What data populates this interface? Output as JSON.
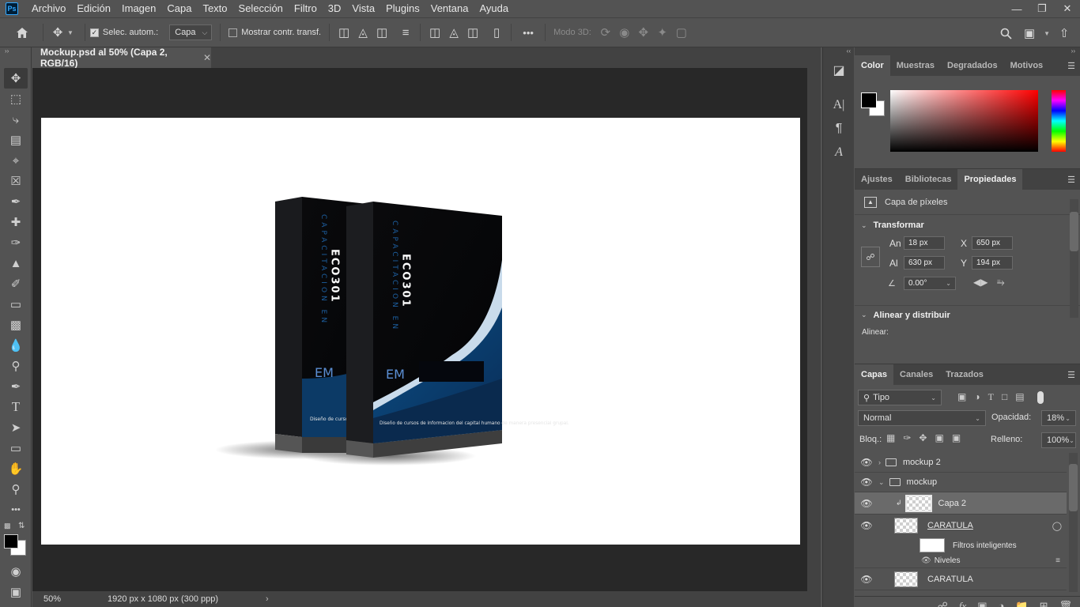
{
  "app": {
    "logo_text": "Ps",
    "menu": [
      "Archivo",
      "Edición",
      "Imagen",
      "Capa",
      "Texto",
      "Selección",
      "Filtro",
      "3D",
      "Vista",
      "Plugins",
      "Ventana",
      "Ayuda"
    ]
  },
  "options_bar": {
    "auto_select_label": "Selec. autom.:",
    "auto_select_checked": true,
    "auto_select_target": "Capa",
    "show_transform_label": "Mostrar contr. transf.",
    "show_transform_checked": false,
    "mode3d_label": "Modo 3D:",
    "more_label": "•••"
  },
  "document": {
    "tab_title": "Mockup.psd al 50% (Capa 2, RGB/16)",
    "zoom": "50%",
    "info": "1920 px x 1080 px (300 ppp)"
  },
  "mockup": {
    "vertical_text_a": "CAPACITACION EN",
    "vertical_text_b": "ECO301",
    "logo_text": "EM",
    "caption_front": "Diseño de cursos de informacion del capital humano de manera presencial grupal.",
    "caption_back": "Diseño de cursos capital humano d"
  },
  "color_panel": {
    "tabs": [
      "Color",
      "Muestras",
      "Degradados",
      "Motivos"
    ],
    "active_tab": "Color",
    "foreground": "#000000",
    "background": "#ffffff"
  },
  "properties_panel": {
    "tabs": [
      "Ajustes",
      "Bibliotecas",
      "Propiedades"
    ],
    "active_tab": "Propiedades",
    "layer_type": "Capa de píxeles",
    "transform_title": "Transformar",
    "width_label": "An",
    "width": "18 px",
    "height_label": "Al",
    "height": "630 px",
    "x_label": "X",
    "x": "650 px",
    "y_label": "Y",
    "y": "194 px",
    "angle": "0.00°",
    "align_title": "Alinear y distribuir",
    "align_label": "Alinear:"
  },
  "layers_panel": {
    "tabs": [
      "Capas",
      "Canales",
      "Trazados"
    ],
    "active_tab": "Capas",
    "filter_kind": "Tipo",
    "blend_mode": "Normal",
    "opacity_label": "Opacidad:",
    "opacity": "18%",
    "lock_label": "Bloq.:",
    "fill_label": "Relleno:",
    "fill": "100%",
    "layers": [
      {
        "name": "mockup 2",
        "kind": "group",
        "collapsed": true
      },
      {
        "name": "mockup",
        "kind": "group",
        "collapsed": false
      },
      {
        "name": "Capa 2",
        "kind": "pixel",
        "selected": true
      },
      {
        "name": "CARATULA",
        "kind": "smart"
      },
      {
        "name": "Filtros inteligentes",
        "kind": "filter-mask"
      },
      {
        "name": "Niveles",
        "kind": "filter"
      },
      {
        "name": "CARATULA",
        "kind": "smart"
      }
    ]
  }
}
